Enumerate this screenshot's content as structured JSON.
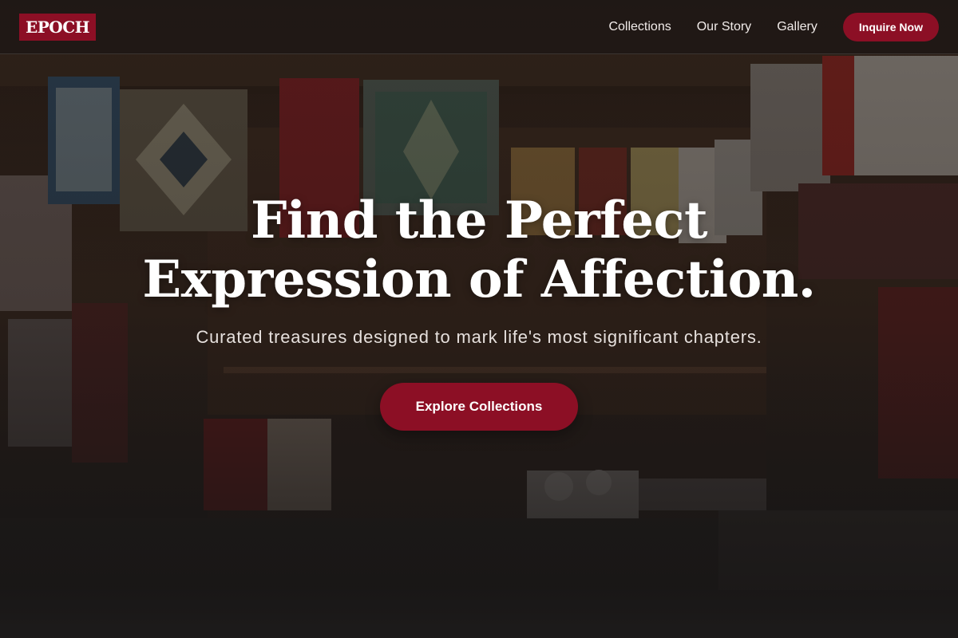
{
  "header": {
    "logo_text": "EPOCH",
    "nav_links": [
      {
        "label": "Collections"
      },
      {
        "label": "Our Story"
      },
      {
        "label": "Gallery"
      }
    ],
    "cta_label": "Inquire Now"
  },
  "hero": {
    "title_line_1": "Find the Perfect",
    "title_line_2": "Expression of Affection.",
    "subtitle": "Curated treasures designed to mark life's most significant chapters.",
    "cta_label": "Explore Collections",
    "background": "photo of a market stall hung with woven rugs, embroidered textiles and souvenirs"
  },
  "colors": {
    "accent": "#8c0f25",
    "header_bg": "#1e1816",
    "text_primary": "#ffffff",
    "text_secondary": "#e6e0dd"
  }
}
